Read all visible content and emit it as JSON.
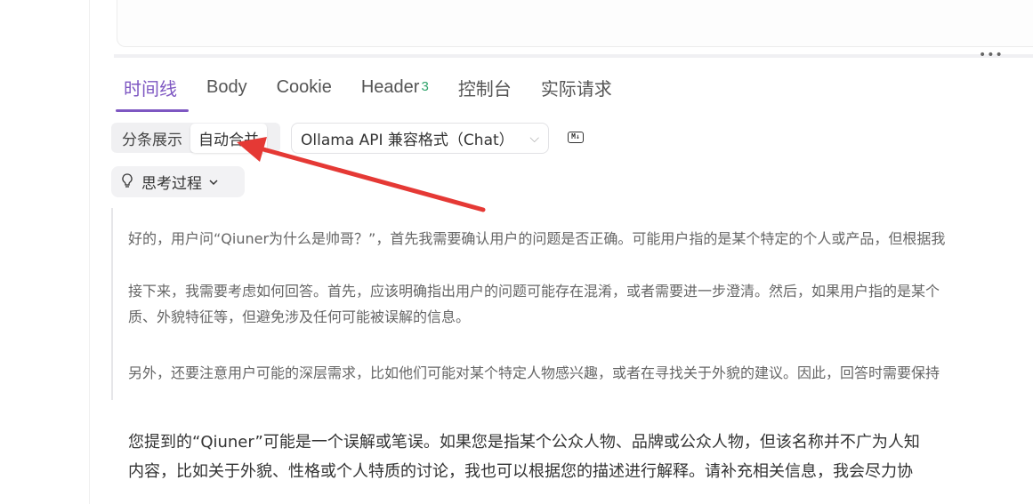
{
  "tabs": [
    {
      "label": "时间线",
      "active": true
    },
    {
      "label": "Body"
    },
    {
      "label": "Cookie"
    },
    {
      "label": "Header",
      "badge": "3"
    },
    {
      "label": "控制台"
    },
    {
      "label": "实际请求"
    }
  ],
  "display_mode": {
    "options": [
      "分条展示",
      "自动合并"
    ],
    "selected": "自动合并"
  },
  "format_select": {
    "value": "Ollama API 兼容格式（Chat）"
  },
  "markdown_icon_label": "M↓",
  "more_dots": "•••",
  "thinking": {
    "label": "思考过程",
    "paragraphs": [
      "好的，用户问“Qiuner为什么是帅哥？”，首先我需要确认用户的问题是否正确。可能用户指的是某个特定的个人或产品，但根据我",
      "接下来，我需要考虑如何回答。首先，应该明确指出用户的问题可能存在混淆，或者需要进一步澄清。然后，如果用户指的是某个",
      "质、外貌特征等，但避免涉及任何可能被误解的信息。",
      "另外，还要注意用户可能的深层需求，比如他们可能对某个特定人物感兴趣，或者在寻找关于外貌的建议。因此，回答时需要保持"
    ]
  },
  "answer": {
    "lines": [
      "您提到的“Qiuner”可能是一个误解或笔误。如果您是指某个公众人物、品牌或公众人物，但该名称并不广为人知",
      "内容，比如关于外貌、性格或个人特质的讨论，我也可以根据您的描述进行解释。请补充相关信息，我会尽力协"
    ]
  },
  "colors": {
    "accent": "#7e57c2",
    "badge": "#2fa36b",
    "annotation_arrow": "#e53935"
  }
}
